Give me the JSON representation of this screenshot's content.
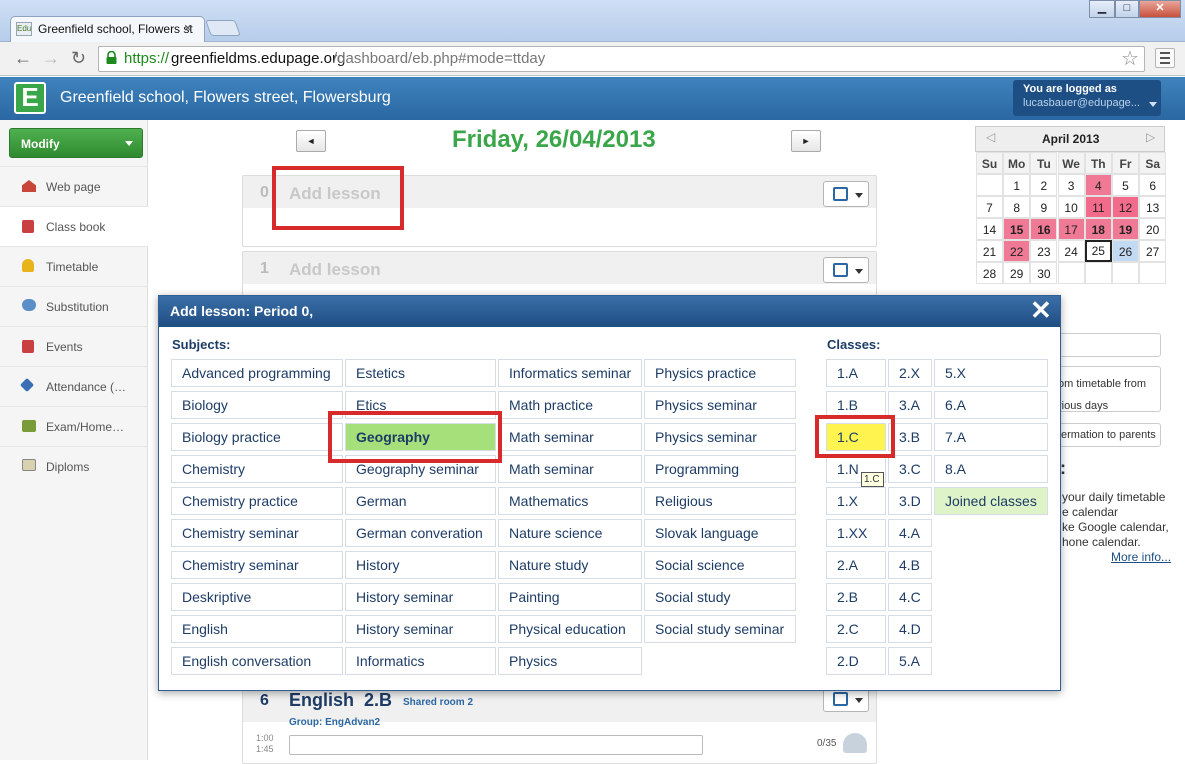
{
  "browser": {
    "tab_title": "Greenfield school, Flowers st",
    "tab_favicon_text": "Edu",
    "url_scheme": "https://",
    "url_host": "greenfieldms.edupage.org",
    "url_path": "/dashboard/eb.php#mode=ttday",
    "window_buttons": {
      "minimize": "▁",
      "maximize": "□",
      "close": "✕"
    }
  },
  "app": {
    "logo_letter": "E",
    "school_name": "Greenfield school, Flowers street, Flowersburg",
    "login_label": "You are logged as",
    "login_user": "lucasbauer@edupage...",
    "brand_color": "#2a67a3"
  },
  "sidebar": {
    "modify_label": "Modify",
    "items": [
      {
        "label": "Web page",
        "icon": "house-icon"
      },
      {
        "label": "Class book",
        "icon": "book-icon"
      },
      {
        "label": "Timetable",
        "icon": "bell-icon"
      },
      {
        "label": "Substitution",
        "icon": "people-icon"
      },
      {
        "label": "Events",
        "icon": "calendar-book-icon"
      },
      {
        "label": "Attendance (…",
        "icon": "attendance-icon"
      },
      {
        "label": "Exam/Home…",
        "icon": "exam-icon"
      },
      {
        "label": "Diploms",
        "icon": "diploma-icon"
      }
    ]
  },
  "day": {
    "prev": "◄",
    "next": "►",
    "title": "Friday, 26/04/2013"
  },
  "lessons": [
    {
      "number": "0",
      "title": "Add lesson"
    },
    {
      "number": "1",
      "title": "Add lesson"
    }
  ],
  "lesson6": {
    "number": "6",
    "subject": "English",
    "class": "2.B",
    "room": "Shared room 2",
    "group": "Group: EngAdvan2",
    "time_start": "1:00",
    "time_end": "1:45",
    "count": "0/35"
  },
  "calendar": {
    "prev": "◁",
    "next": "▷",
    "title": "April 2013",
    "dow": [
      "Su",
      "Mo",
      "Tu",
      "We",
      "Th",
      "Fr",
      "Sa"
    ],
    "weeks": [
      [
        "",
        "1",
        "2",
        "3",
        "4",
        "5",
        "6"
      ],
      [
        "7",
        "8",
        "9",
        "10",
        "11",
        "12",
        "13"
      ],
      [
        "14",
        "15",
        "16",
        "17",
        "18",
        "19",
        "20"
      ],
      [
        "21",
        "22",
        "23",
        "24",
        "25",
        "26",
        "27"
      ],
      [
        "28",
        "29",
        "30",
        "",
        "",
        "",
        ""
      ]
    ],
    "highlight_color": "#f07a95"
  },
  "right_panel": {
    "timetable_text_1": "om timetable from",
    "timetable_text_2": "rious days",
    "parents_text": "ermation to parents",
    "colon": ":",
    "info_1": "your daily timetable",
    "info_2": "e calendar",
    "info_3": "ke Google calendar,",
    "info_4": "hone calendar.",
    "more_info": "More info..."
  },
  "modal": {
    "title": "Add lesson: Period 0,",
    "close": "✕",
    "subjects_label": "Subjects:",
    "classes_label": "Classes:",
    "subjects": [
      [
        "Advanced programming",
        "Estetics",
        "Informatics seminar",
        "Physics practice"
      ],
      [
        "Biology",
        "Etics",
        "Math practice",
        "Physics seminar"
      ],
      [
        "Biology practice",
        "Geography",
        "Math seminar",
        "Physics seminar"
      ],
      [
        "Chemistry",
        "Geography seminar",
        "Math seminar",
        "Programming"
      ],
      [
        "Chemistry practice",
        "German",
        "Mathematics",
        "Religious"
      ],
      [
        "Chemistry seminar",
        "German converation",
        "Nature science",
        "Slovak language"
      ],
      [
        "Chemistry seminar",
        "History",
        "Nature study",
        "Social science"
      ],
      [
        "Deskriptive",
        "History seminar",
        "Painting",
        "Social study"
      ],
      [
        "English",
        "History seminar",
        "Physical education",
        "Social study seminar"
      ],
      [
        "English conversation",
        "Informatics",
        "Physics",
        ""
      ]
    ],
    "classes": [
      [
        "1.A",
        "2.X",
        "5.X"
      ],
      [
        "1.B",
        "3.A",
        "6.A"
      ],
      [
        "1.C",
        "3.B",
        "7.A"
      ],
      [
        "1.N",
        "3.C",
        "8.A"
      ],
      [
        "1.X",
        "3.D",
        "Joined classes"
      ],
      [
        "1.XX",
        "4.A",
        ""
      ],
      [
        "2.A",
        "4.B",
        ""
      ],
      [
        "2.B",
        "4.C",
        ""
      ],
      [
        "2.C",
        "4.D",
        ""
      ],
      [
        "2.D",
        "5.A",
        ""
      ]
    ],
    "selected_subject_color": "#a6e07a",
    "selected_class_color": "#fff44f",
    "tooltip": "1.C"
  }
}
